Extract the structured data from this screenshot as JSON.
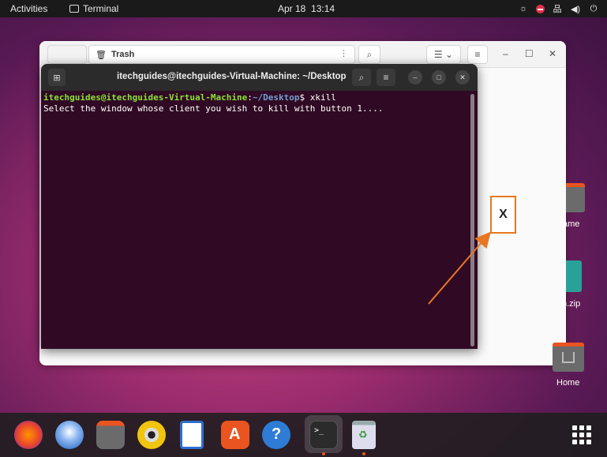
{
  "topbar": {
    "activities": "Activities",
    "app_name": "Terminal",
    "date": "Apr 18",
    "time": "13:14"
  },
  "files": {
    "path": "Trash",
    "menu_icon": "⋮",
    "min": "–",
    "max": "☐",
    "close": "✕"
  },
  "terminal": {
    "title": "itechguides@itechguides-Virtual-Machine: ~/Desktop",
    "prompt_user": "itechguides@itechguides-Virtual-Machine",
    "prompt_sep": ":",
    "prompt_path": "~/Desktop",
    "prompt_dollar": "$ ",
    "command": "xkill",
    "output": "Select the window whose client you wish to kill with button 1...."
  },
  "desktop": {
    "icon1_label": "ame",
    "icon2_label": "n.zip",
    "home_label": "Home"
  },
  "annotation": {
    "marker": "X",
    "color": "#e87722"
  }
}
